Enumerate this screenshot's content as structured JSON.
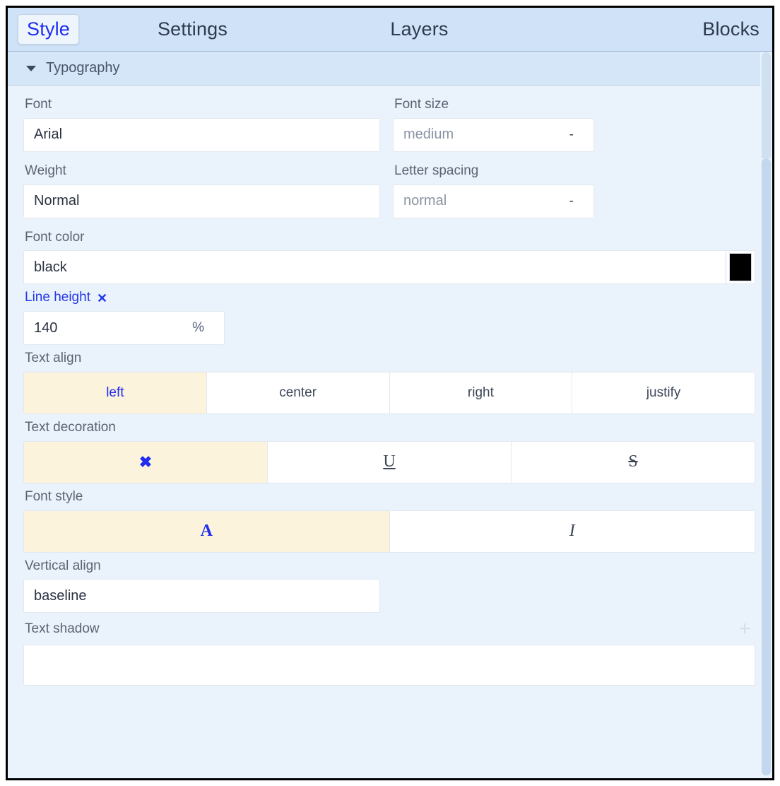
{
  "window": {
    "border_color": "#000000",
    "body_bg": "#eaf2fc",
    "header_bg": "#cfe2f7",
    "accent_blue": "#1f2df0",
    "selected_bg": "#fcf3dc"
  },
  "tabs": [
    {
      "label": "Style",
      "active": true
    },
    {
      "label": "Settings",
      "active": false
    },
    {
      "label": "Layers",
      "active": false
    },
    {
      "label": "Blocks",
      "active": false
    }
  ],
  "sector": {
    "title": "Typography",
    "caret": "caret-down-icon",
    "expanded": true
  },
  "properties": {
    "font": {
      "label": "Font",
      "value": "Arial",
      "is_placeholder": false
    },
    "font_size": {
      "label": "Font size",
      "value": "medium",
      "is_placeholder": true,
      "unit": "-"
    },
    "weight": {
      "label": "Weight",
      "value": "Normal",
      "is_placeholder": false
    },
    "letter_spacing": {
      "label": "Letter spacing",
      "value": "normal",
      "is_placeholder": true,
      "unit": "-"
    },
    "font_color": {
      "label": "Font color",
      "value": "black",
      "swatch": "#000000"
    },
    "line_height": {
      "label": "Line height",
      "value": "140",
      "unit": "%",
      "modified": true,
      "clear_icon": "close-x-icon"
    },
    "text_align": {
      "label": "Text align",
      "options": [
        {
          "label": "left",
          "selected": true
        },
        {
          "label": "center",
          "selected": false
        },
        {
          "label": "right",
          "selected": false
        },
        {
          "label": "justify",
          "selected": false
        }
      ]
    },
    "text_decoration": {
      "label": "Text decoration",
      "options": [
        {
          "label": "✖",
          "icon": "none-x-icon",
          "selected": true
        },
        {
          "label": "U",
          "icon": "underline-icon",
          "selected": false
        },
        {
          "label": "S",
          "icon": "strikethrough-icon",
          "selected": false
        }
      ]
    },
    "font_style": {
      "label": "Font style",
      "options": [
        {
          "label": "A",
          "icon": "normal-a-icon",
          "selected": true
        },
        {
          "label": "I",
          "icon": "italic-i-icon",
          "selected": false
        }
      ]
    },
    "vertical_align": {
      "label": "Vertical align",
      "value": "baseline"
    },
    "text_shadow": {
      "label": "Text shadow",
      "add_icon": "plus-icon",
      "value": ""
    }
  }
}
